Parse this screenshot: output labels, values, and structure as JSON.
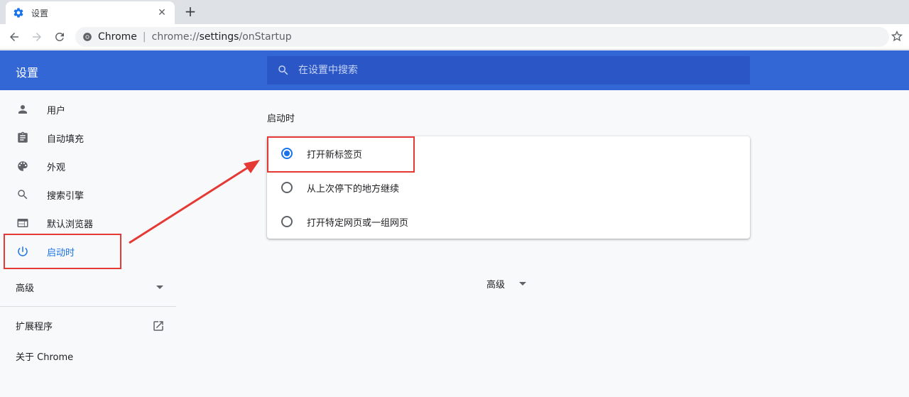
{
  "tab": {
    "title": "设置",
    "icon": "gear-icon",
    "close_glyph": "✕"
  },
  "new_tab_glyph": "+",
  "omnibox": {
    "site": "Chrome",
    "url_scheme": "chrome://",
    "url_host": "settings",
    "url_path": "/onStartup"
  },
  "header": {
    "title": "设置",
    "search_placeholder": "在设置中搜索"
  },
  "sidebar": {
    "items": [
      {
        "label": "用户",
        "icon": "person-icon"
      },
      {
        "label": "自动填充",
        "icon": "clipboard-icon"
      },
      {
        "label": "外观",
        "icon": "palette-icon"
      },
      {
        "label": "搜索引擎",
        "icon": "search-icon"
      },
      {
        "label": "默认浏览器",
        "icon": "browser-window-icon"
      },
      {
        "label": "启动时",
        "icon": "power-icon",
        "active": true
      }
    ],
    "advanced": "高级",
    "extensions": "扩展程序",
    "about": "关于 Chrome"
  },
  "main": {
    "section_title": "启动时",
    "options": [
      {
        "label": "打开新标签页",
        "checked": true
      },
      {
        "label": "从上次停下的地方继续",
        "checked": false
      },
      {
        "label": "打开特定网页或一组网页",
        "checked": false
      }
    ],
    "advanced": "高级"
  },
  "colors": {
    "header": "#3367d6",
    "accent": "#1a73e8",
    "annotation": "#e53935"
  }
}
